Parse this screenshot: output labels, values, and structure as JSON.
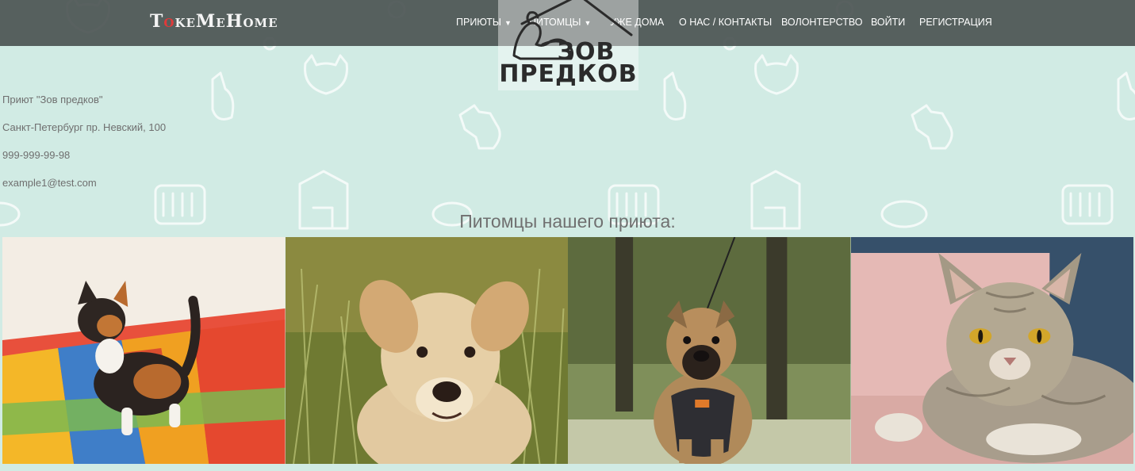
{
  "navbar": {
    "brand": {
      "prefix": "T",
      "accent": "o",
      "suffix": "keMeHome"
    },
    "items": [
      {
        "label": "Приюты",
        "has_dropdown": true
      },
      {
        "label": "Питомцы",
        "has_dropdown": true
      },
      {
        "label": "Уже дома",
        "has_dropdown": false
      },
      {
        "label": "О нас / Контакты",
        "has_dropdown": false
      },
      {
        "label": "Волонтерство",
        "has_dropdown": false
      },
      {
        "label": "Войти",
        "has_dropdown": false
      },
      {
        "label": "Регистрация",
        "has_dropdown": false
      }
    ],
    "dropdown_icon": "chevron-down-icon"
  },
  "shelter_logo": {
    "line1": "ЗОВ",
    "line2": "ПРЕДКОВ"
  },
  "shelter_info": {
    "name": "Приют \"Зов предков\"",
    "address": "Санкт-Петербург пр. Невский, 100",
    "phone": "999-999-99-98",
    "email": "example1@test.com"
  },
  "pets_section": {
    "title": "Питомцы нашего приюта:"
  },
  "pets": [
    {
      "kind": "kitten"
    },
    {
      "kind": "puppy"
    },
    {
      "kind": "dog"
    },
    {
      "kind": "cat"
    }
  ],
  "colors": {
    "background": "#d1ebe4",
    "navbar": "#4b5452",
    "brand_accent": "#e03a3a"
  }
}
